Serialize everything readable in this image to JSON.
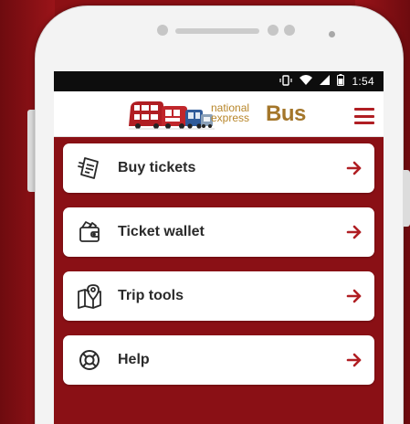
{
  "status": {
    "time": "1:54",
    "icons": [
      "vibrate-icon",
      "wifi-icon",
      "signal-icon",
      "battery-icon"
    ]
  },
  "brand": {
    "small_line1": "national",
    "small_line2": "express",
    "big": "Bus",
    "menu_icon": "hamburger-menu-icon"
  },
  "colors": {
    "brand_red": "#b01e23",
    "background_red": "#8a1015",
    "gold": "#a4762a"
  },
  "menu": [
    {
      "label": "Buy tickets",
      "icon": "ticket-icon",
      "arrow": "arrow-right-icon"
    },
    {
      "label": "Ticket wallet",
      "icon": "wallet-icon",
      "arrow": "arrow-right-icon"
    },
    {
      "label": "Trip tools",
      "icon": "map-pin-icon",
      "arrow": "arrow-right-icon"
    },
    {
      "label": "Help",
      "icon": "lifebuoy-icon",
      "arrow": "arrow-right-icon"
    }
  ]
}
